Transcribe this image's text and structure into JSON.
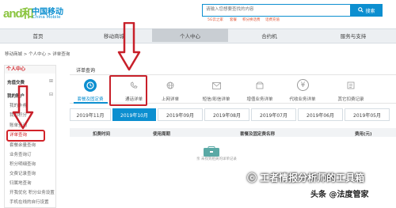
{
  "header": {
    "logo_mark": "and和",
    "logo_cn": "中国移动",
    "logo_en": "China Mobile",
    "search_placeholder": "请输入您想要查找的内容",
    "search_label": "搜索",
    "hot_links": [
      "5G云之家",
      "套餐",
      "积分换话费",
      "话费充值"
    ]
  },
  "nav": {
    "items": [
      "首页",
      "移动商城",
      "个人中心",
      "合约机",
      "服务与支持"
    ],
    "active": "个人中心"
  },
  "breadcrumb": "移动商城 > 个人中心 > 详单查询",
  "sidebar": {
    "title": "个人中心",
    "groups": [
      {
        "label": "充值交费",
        "items": []
      },
      {
        "label": "我的账户",
        "items": [
          "我的卡券",
          "我的积分",
          "账单查询",
          "详单查询",
          "套餐余量查询",
          "业务查询订",
          "积分明细查询",
          "交费记录查询",
          "归属地查询",
          "开我优化 积分业务设置",
          "手机在线的自行设置"
        ]
      }
    ],
    "selected": "详单查询"
  },
  "main": {
    "title": "详单查询",
    "tabs": [
      {
        "label": "套餐及固定费",
        "icon": "clock-icon",
        "active": true
      },
      {
        "label": "通话详单",
        "icon": "phone-icon",
        "active": false
      },
      {
        "label": "上网详单",
        "icon": "globe-icon",
        "active": false
      },
      {
        "label": "短信/彩信详单",
        "icon": "mail-icon",
        "active": false
      },
      {
        "label": "增值业务详单",
        "icon": "box-icon",
        "active": false
      },
      {
        "label": "代收业务详单",
        "icon": "yuan-icon",
        "active": false
      },
      {
        "label": "其它扣费记录",
        "icon": "list-icon",
        "active": false
      }
    ],
    "months": [
      "2019年11月",
      "2019年10月",
      "2019年09月",
      "2019年08月",
      "2019年07月",
      "2019年06月",
      "2019年05月"
    ],
    "active_month": "2019年10月",
    "table_headers": [
      "扣费时间",
      "使用周期",
      "套餐及固定费名称",
      "费用(元)"
    ],
    "empty_text": "亲 未找到相关的详单记录"
  },
  "watermark": {
    "wechat_text": "ⓒ 工者情报分析师的工具箱",
    "source": "头条 @法度管家"
  },
  "colors": {
    "brand": "#0c8fd0",
    "highlight": "#d2232a",
    "logo_green": "#8ac43f"
  }
}
